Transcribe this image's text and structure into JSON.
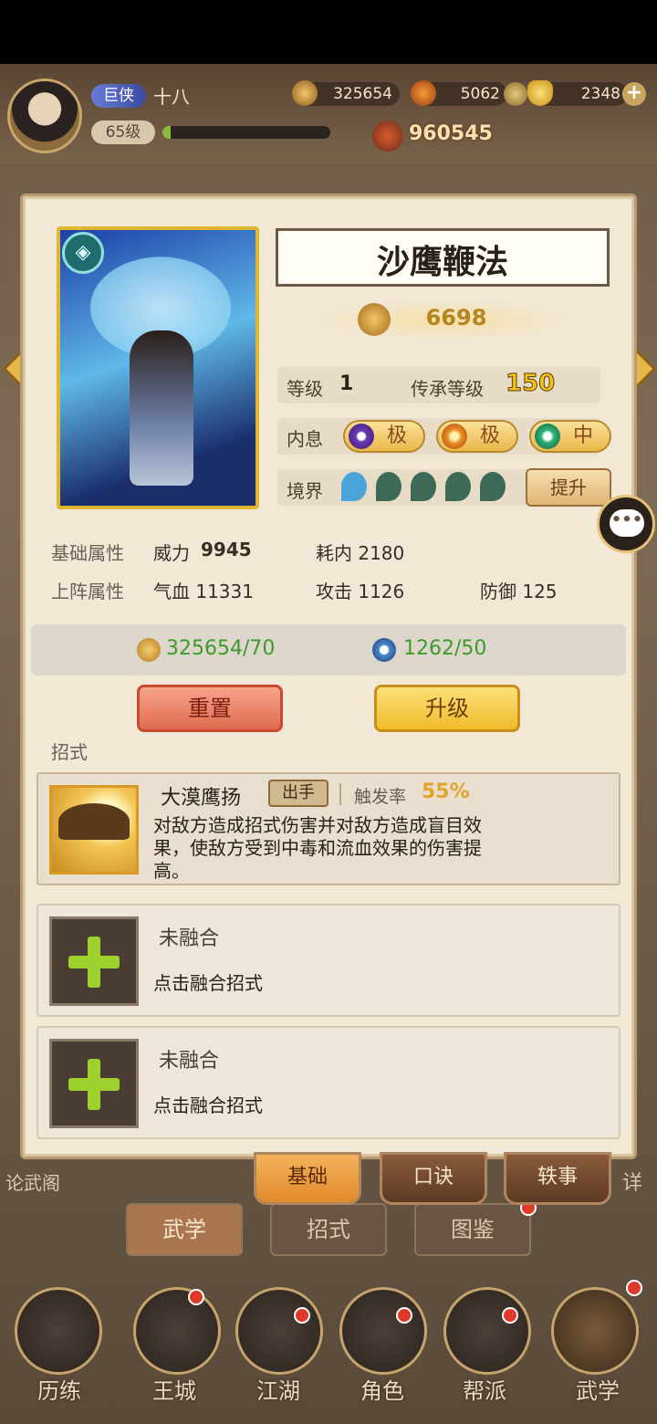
{
  "player": {
    "rank_badge": "巨侠",
    "name": "十八",
    "level": "65级",
    "exp_fraction": 0.05,
    "power": "960545"
  },
  "resources": {
    "copper": "325654",
    "energy": "5062",
    "gold": "2348"
  },
  "skill": {
    "name": "沙鹰鞭法",
    "score": "6698",
    "level_label": "等级",
    "level_value": "1",
    "inherit_label": "传承等级",
    "inherit_value": "150",
    "inner_label": "内息",
    "inner_grades": [
      "极",
      "极",
      "中"
    ],
    "realm_label": "境界",
    "realm_button": "提升"
  },
  "stats": {
    "base_label": "基础属性",
    "power_label": "威力",
    "power_value": "9945",
    "consume": "耗内 2180",
    "deploy_label": "上阵属性",
    "hp": "气血 11331",
    "atk": "攻击 1126",
    "def": "防御 125"
  },
  "costs": {
    "copper": "325654/70",
    "essence": "1262/50"
  },
  "buttons": {
    "reset": "重置",
    "upgrade": "升级"
  },
  "moves": {
    "section_label": "招式",
    "move1_name": "大漠鹰扬",
    "move1_tag": "出手",
    "move1_rate_label": "触发率",
    "move1_rate": "55%",
    "move1_desc_1": "对敌方造成招式伤害并对敌方造成盲目效",
    "move1_desc_2": "果，使敌方受到中毒和流血效果的伤害提",
    "move1_desc_3": "高。",
    "empty_title": "未融合",
    "empty_sub": "点击融合招式"
  },
  "panel_tabs": [
    "基础",
    "口诀",
    "轶事"
  ],
  "under_tabs": [
    "武学",
    "招式",
    "图鉴"
  ],
  "side_texts": {
    "left": "论武阁",
    "right": "详"
  },
  "bottom_nav": [
    "历练",
    "王城",
    "江湖",
    "角色",
    "帮派",
    "武学"
  ],
  "colors": {
    "accent_gold": "#f2c21a",
    "cost_green": "#3f9a2c",
    "reset_red": "#e06b4f"
  }
}
